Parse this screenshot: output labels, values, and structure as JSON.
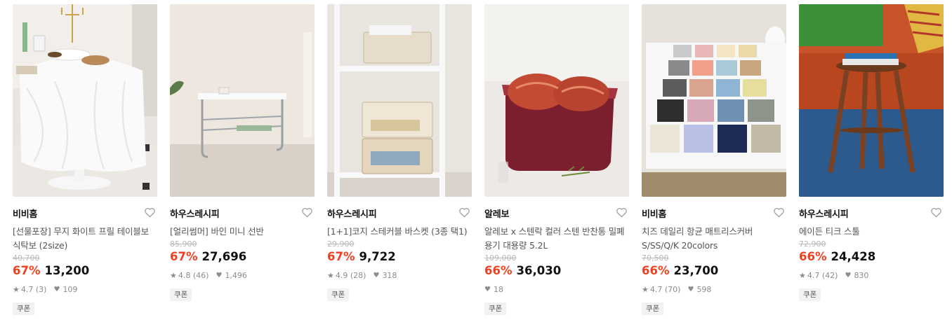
{
  "products": [
    {
      "brand": "비비홈",
      "title": "[선물포장] 무지 화이트 프릴 테이블보 식탁보 (2size)",
      "original_price": "40,700",
      "discount": "67%",
      "price": "13,200",
      "rating": "4.7",
      "reviews": "(3)",
      "likes": "109",
      "badge": "쿠폰"
    },
    {
      "brand": "하우스레시피",
      "title": "[얼리썸머] 바인 미니 선반",
      "original_price": "85,900",
      "discount": "67%",
      "price": "27,696",
      "rating": "4.8",
      "reviews": "(46)",
      "likes": "1,496",
      "badge": "쿠폰"
    },
    {
      "brand": "하우스레시피",
      "title": "[1+1]코지 스테커블 바스켓 (3종 택1)",
      "original_price": "29,900",
      "discount": "67%",
      "price": "9,722",
      "rating": "4.9",
      "reviews": "(28)",
      "likes": "318",
      "badge": "쿠폰"
    },
    {
      "brand": "알레보",
      "title": "알레보 x 스텐락 컬러 스텐 반찬통 밀폐용기 대용량 5.2L",
      "original_price": "109,000",
      "discount": "66%",
      "price": "36,030",
      "likes": "18",
      "badge": "쿠폰"
    },
    {
      "brand": "비비홈",
      "title": "치즈 데일리 항균 매트리스커버 S/SS/Q/K 20colors",
      "original_price": "70,500",
      "discount": "66%",
      "price": "23,700",
      "rating": "4.7",
      "reviews": "(70)",
      "likes": "598",
      "badge": "쿠폰"
    },
    {
      "brand": "하우스레시피",
      "title": "에이든 티크 스툴",
      "original_price": "72,900",
      "discount": "66%",
      "price": "24,428",
      "rating": "4.7",
      "reviews": "(42)",
      "likes": "830",
      "badge": "쿠폰"
    }
  ],
  "colors": {
    "discount": "#f0401f",
    "badge_bg": "#f2f2f2",
    "muted": "#8c8c8c"
  },
  "icons": {
    "wishlist": "heart-outline-icon",
    "rating": "star-icon",
    "likes": "heart-icon"
  }
}
